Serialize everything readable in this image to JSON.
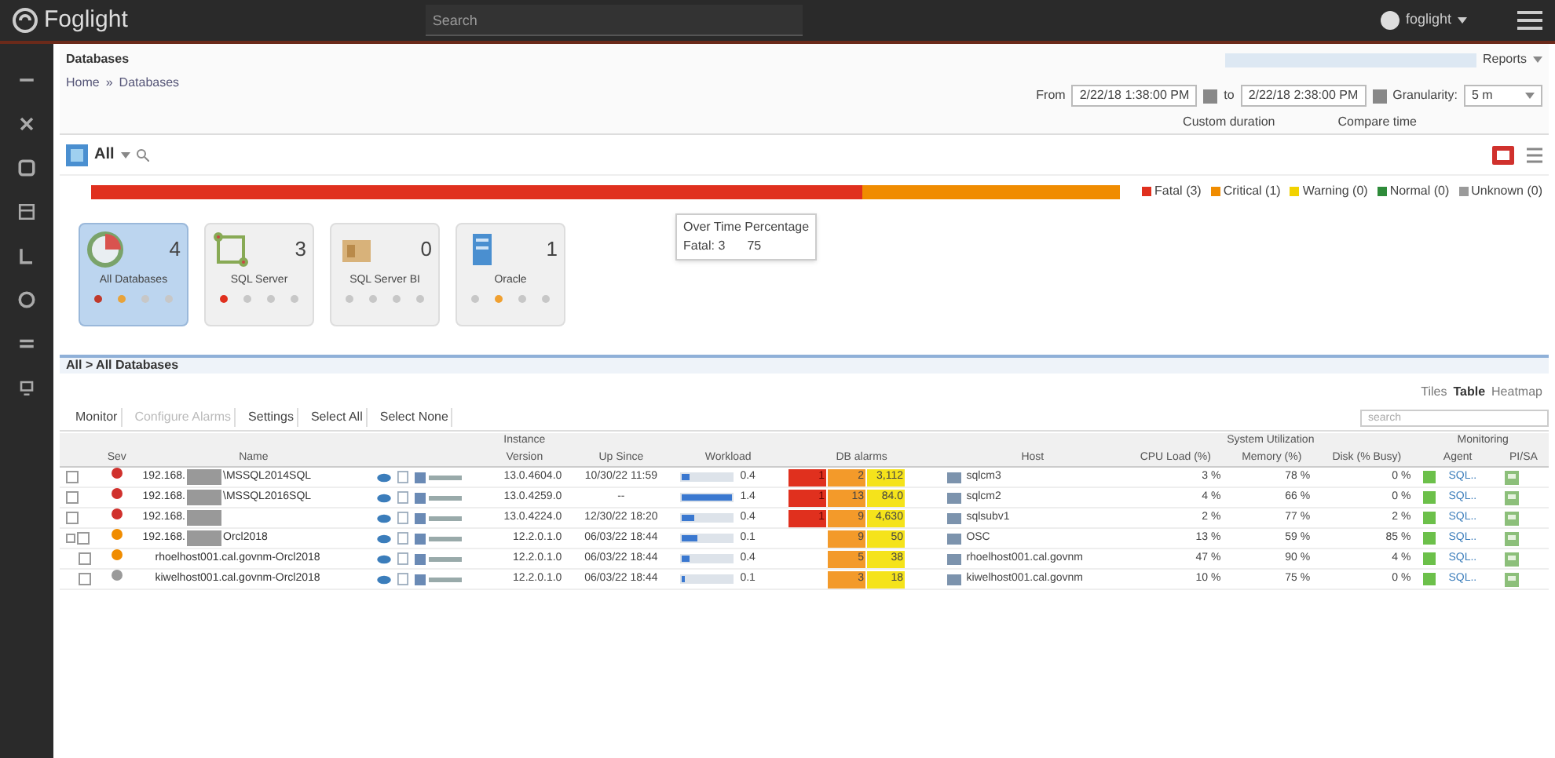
{
  "app": {
    "name": "Foglight",
    "search": {
      "placeholder": "Search"
    },
    "user": "foglight"
  },
  "page": {
    "title": "Databases",
    "breadcrumb": [
      "Home",
      "Databases"
    ],
    "breadcrumb_separator": "»",
    "time": {
      "from_label": "From",
      "from": "2/22/18 1:38:00 PM",
      "to_label": "to",
      "to": "2/22/18 2:38:00 PM",
      "granularity_label": "Granularity:",
      "granularity": "5 m",
      "custom_duration": "Custom duration",
      "compare_time": "Compare time"
    },
    "reports": "Reports"
  },
  "filter": {
    "label": "All"
  },
  "legend": [
    {
      "label": "Fatal",
      "count": "(3)",
      "color": "#e0301e"
    },
    {
      "label": "Critical",
      "count": "(1)",
      "color": "#f08c00"
    },
    {
      "label": "Warning",
      "count": "(0)",
      "color": "#f2d200"
    },
    {
      "label": "Normal",
      "count": "(0)",
      "color": "#2e8b3a"
    },
    {
      "label": "Unknown",
      "count": "(0)",
      "color": "#9a9a9a"
    }
  ],
  "tooltip": {
    "title": "Over Time Percentage",
    "value": "Fatal: 3",
    "extra": "75"
  },
  "tiles": [
    {
      "name": "All Databases",
      "count": "4",
      "selected": true,
      "dots": [
        {
          "color": "#c0392b"
        },
        {
          "color": "#e8a33a"
        },
        {
          "color": "#c7c7c7"
        },
        {
          "color": "#c7c7c7"
        }
      ]
    },
    {
      "name": "SQL Server",
      "count": "3",
      "selected": false,
      "dots": [
        {
          "color": "#e0301e"
        },
        {
          "color": "#c7c7c7"
        },
        {
          "color": "#c7c7c7"
        },
        {
          "color": "#c7c7c7"
        }
      ]
    },
    {
      "name": "SQL Server BI",
      "count": "0",
      "selected": false,
      "dots": [
        {
          "color": "#c7c7c7"
        },
        {
          "color": "#c7c7c7"
        },
        {
          "color": "#c7c7c7"
        },
        {
          "color": "#c7c7c7"
        }
      ]
    },
    {
      "name": "Oracle",
      "count": "1",
      "selected": false,
      "dots": [
        {
          "color": "#c7c7c7"
        },
        {
          "color": "#f0a030"
        },
        {
          "color": "#c7c7c7"
        },
        {
          "color": "#c7c7c7"
        }
      ]
    }
  ],
  "panel": {
    "title": "All > All Databases",
    "views": [
      {
        "label": "Tiles",
        "selected": false
      },
      {
        "label": "Table",
        "selected": true
      },
      {
        "label": "Heatmap",
        "selected": false
      }
    ],
    "toolbar": [
      {
        "label": "Monitor",
        "disabled": false
      },
      {
        "label": "Configure Alarms",
        "disabled": true
      },
      {
        "label": "Settings",
        "disabled": false
      },
      {
        "label": "Select All",
        "disabled": false
      },
      {
        "label": "Select None",
        "disabled": false
      }
    ],
    "search": {
      "placeholder": "search"
    }
  },
  "table": {
    "groups": {
      "instance": "Instance",
      "system": "System Utilization",
      "monitoring": "Monitoring"
    },
    "columns": [
      "Sev",
      "Name",
      "Version",
      "Up Since",
      "Workload",
      "DB alarms",
      "Host",
      "CPU Load (%)",
      "Memory (%)",
      "Disk (% Busy)",
      "Agent",
      "PI/SA"
    ],
    "rows": [
      {
        "checked": false,
        "color": "#d0312d",
        "name_start": "192.168.",
        "name_end": "\\MSSQL2014SQL",
        "version": "13.0.4604.0",
        "up_since": "10/30/22 11:59",
        "workload": {
          "level": 0.15,
          "reading": "0.4"
        },
        "fatal": "1",
        "critical": "2",
        "warning": "3,112",
        "host": "sqlcm3",
        "cpu": "3 %",
        "memory": "78 %",
        "disk": "0 %",
        "agent": "SQL.."
      },
      {
        "checked": false,
        "color": "#d0312d",
        "name_start": "192.168.",
        "name_end": "\\MSSQL2016SQL",
        "version": "13.0.4259.0",
        "up_since": "--",
        "workload": {
          "level": 1,
          "reading": "1.4"
        },
        "fatal": "1",
        "critical": "13",
        "warning": "84.0",
        "host": "sqlcm2",
        "cpu": "4 %",
        "memory": "66 %",
        "disk": "0 %",
        "agent": "SQL.."
      },
      {
        "checked": false,
        "color": "#d0312d",
        "name_start": "192.168.",
        "version": "13.0.4224.0",
        "up_since": "12/30/22 18:20",
        "workload": {
          "level": 0.25,
          "reading": "0.4"
        },
        "fatal": "1",
        "critical": "9",
        "warning": "4,630",
        "host": "sqlsubv1",
        "cpu": "2 %",
        "memory": "77 %",
        "disk": "2 %",
        "agent": "SQL.."
      },
      {
        "checked": false,
        "color": "#f08c00",
        "name_start": "192.168.",
        "name_end": "Orcl2018",
        "version": "12.2.0.1.0",
        "up_since": "06/03/22 18:44",
        "workload": {
          "level": 0.3,
          "reading": "0.1"
        },
        "critical": "9",
        "warning": "50",
        "host": "OSC",
        "cpu": "13 %",
        "memory": "59 %",
        "disk": "85 %",
        "agent": "SQL..",
        "children": [
          {
            "checked": false,
            "color": "#f08c00",
            "name_start": "rhoelhost001.cal.govnm-Orcl2018",
            "version": "12.2.0.1.0",
            "up_since": "06/03/22 18:44",
            "workload": {
              "level": 0.15,
              "reading": "0.4"
            },
            "critical": "5",
            "warning": "38",
            "host": "rhoelhost001.cal.govnm",
            "cpu": "47 %",
            "memory": "90 %",
            "disk": "4 %",
            "agent": "SQL.."
          },
          {
            "checked": false,
            "color": "#9a9a9a",
            "name_start": "kiwelhost001.cal.govnm-Orcl2018",
            "version": "12.2.0.1.0",
            "up_since": "06/03/22 18:44",
            "workload": {
              "level": 0.05,
              "reading": "0.1"
            },
            "critical": "3",
            "warning": "18",
            "host": "kiwelhost001.cal.govnm",
            "cpu": "10 %",
            "memory": "75 %",
            "disk": "0 %",
            "agent": "SQL.."
          }
        ]
      }
    ]
  }
}
